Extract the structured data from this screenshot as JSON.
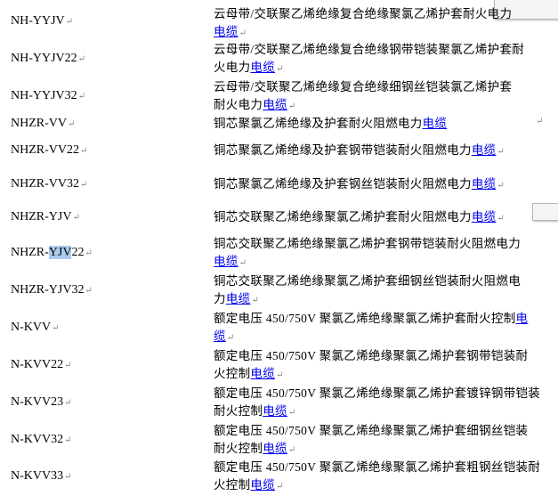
{
  "pilcrow": "↵",
  "link_text": "电缆",
  "rows": [
    {
      "model": "NH-YYJV",
      "line1": "云母带/交联聚乙烯绝缘复合绝缘聚氯乙烯护套耐火电力",
      "line2_pre": "",
      "link_on": "line1_end"
    },
    {
      "model": "NH-YYJV22",
      "line1": "云母带/交联聚乙烯绝缘复合绝缘钢带铠装聚氯乙烯护套耐",
      "line2_pre": "火电力"
    },
    {
      "model": "NH-YYJV32",
      "line1": "云母带/交联聚乙烯绝缘复合绝缘细钢丝铠装氯乙烯护套",
      "line2_pre": "耐火电力"
    },
    {
      "model": "NHZR-VV",
      "line1": "铜芯聚氯乙烯绝缘及护套耐火阻燃电力"
    },
    {
      "model": "NHZR-VV22",
      "line1": "铜芯聚氯乙烯绝缘及护套钢带铠装耐火阻燃电力"
    },
    {
      "model": "NHZR-VV32",
      "line1": "铜芯聚氯乙烯绝缘及护套钢丝铠装耐火阻燃电力"
    },
    {
      "model": "NHZR-YJV",
      "line1": "铜芯交联聚乙烯绝缘聚氯乙烯护套耐火阻燃电力"
    },
    {
      "model_pre": "NHZR-",
      "model_sel": "YJV",
      "model_post": "22",
      "line1": "铜芯交联聚乙烯绝缘聚氯乙烯护套钢带铠装耐火阻燃电力",
      "line2_pre": ""
    },
    {
      "model": "NHZR-YJV32",
      "line1": "铜芯交联聚乙烯绝缘聚氯乙烯护套细钢丝铠装耐火阻燃电",
      "line2_pre": "力"
    },
    {
      "model": "N-KVV",
      "line1": "额定电压 450/750V 聚氯乙烯绝缘聚氯乙烯护套耐火控制",
      "line2_pre": ""
    },
    {
      "model": "N-KVV22",
      "line1": "额定电压 450/750V 聚氯乙烯绝缘聚氯乙烯护套钢带铠装耐",
      "line2_pre": "火控制"
    },
    {
      "model": "N-KVV23",
      "line1": "额定电压 450/750V 聚氯乙烯绝缘聚氯乙烯护套镀锌钢带铠装",
      "line2_pre": "耐火控制"
    },
    {
      "model": "N-KVV32",
      "line1": "额定电压 450/750V 聚氯乙烯绝缘聚氯乙烯护套细钢丝铠装",
      "line2_pre": "耐火控制"
    },
    {
      "model": "N-KVV33",
      "line1": "额定电压 450/750V 聚氯乙烯绝缘聚氯乙烯护套粗钢丝铠装耐",
      "line2_pre": "火控制"
    }
  ]
}
